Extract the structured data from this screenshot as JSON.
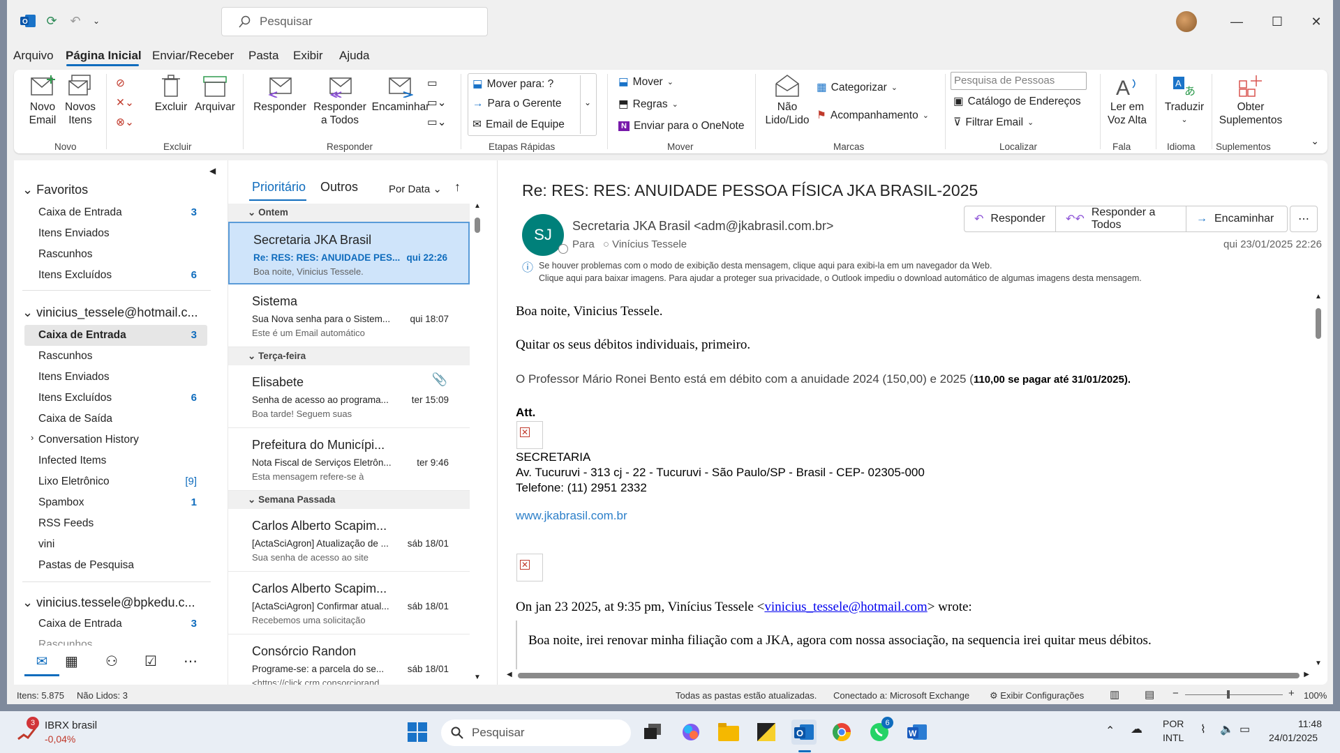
{
  "titlebar": {
    "search_placeholder": "Pesquisar"
  },
  "menu": [
    "Arquivo",
    "Página Inicial",
    "Enviar/Receber",
    "Pasta",
    "Exibir",
    "Ajuda"
  ],
  "ribbon": {
    "novo_email": "Novo\nEmail",
    "novos_itens": "Novos\nItens",
    "excluir": "Excluir",
    "arquivar": "Arquivar",
    "responder": "Responder",
    "responder_todos": "Responder\na Todos",
    "encaminhar": "Encaminhar",
    "qs1": "Mover para: ?",
    "qs2": "Para o Gerente",
    "qs3": "Email de Equipe",
    "mover": "Mover",
    "regras": "Regras",
    "onenote": "Enviar para o OneNote",
    "nao_lido": "Não\nLido/Lido",
    "categorizar": "Categorizar",
    "acompanhamento": "Acompanhamento",
    "pesquisa_pessoas": "Pesquisa de Pessoas",
    "catalogo": "Catálogo de Endereços",
    "filtrar": "Filtrar Email",
    "ler_voz": "Ler em\nVoz Alta",
    "traduzir": "Traduzir",
    "obter": "Obter\nSuplementos",
    "groups": [
      "Novo",
      "Excluir",
      "Responder",
      "Etapas Rápidas",
      "Mover",
      "Marcas",
      "Localizar",
      "Fala",
      "Idioma",
      "Suplementos"
    ]
  },
  "folders": {
    "favoritos": "Favoritos",
    "fav_items": [
      {
        "label": "Caixa de Entrada",
        "count": "3"
      },
      {
        "label": "Itens Enviados",
        "count": ""
      },
      {
        "label": "Rascunhos",
        "count": ""
      },
      {
        "label": "Itens Excluídos",
        "count": "6"
      }
    ],
    "account1": "vinicius_tessele@hotmail.c...",
    "acc1_items": [
      {
        "label": "Caixa de Entrada",
        "count": "3"
      },
      {
        "label": "Rascunhos",
        "count": ""
      },
      {
        "label": "Itens Enviados",
        "count": ""
      },
      {
        "label": "Itens Excluídos",
        "count": "6"
      },
      {
        "label": "Caixa de Saída",
        "count": ""
      },
      {
        "label": "Conversation History",
        "count": ""
      },
      {
        "label": "Infected Items",
        "count": ""
      },
      {
        "label": "Lixo Eletrônico",
        "count": "[9]"
      },
      {
        "label": "Spambox",
        "count": "1"
      },
      {
        "label": "RSS Feeds",
        "count": ""
      },
      {
        "label": "vini",
        "count": ""
      },
      {
        "label": "Pastas de Pesquisa",
        "count": ""
      }
    ],
    "account2": "vinicius.tessele@bpkedu.c...",
    "acc2_items": [
      {
        "label": "Caixa de Entrada",
        "count": "3"
      },
      {
        "label": "Rascunhos",
        "count": ""
      }
    ]
  },
  "list": {
    "tab_prioritario": "Prioritário",
    "tab_outros": "Outros",
    "sort": "Por Data",
    "sep_ontem": "Ontem",
    "sep_terca": "Terça-feira",
    "sep_semana": "Semana Passada",
    "messages": [
      {
        "sender": "Secretaria JKA Brasil",
        "subject": "Re: RES: RES: ANUIDADE PES...",
        "preview": "Boa noite, Vinicius Tessele.",
        "date": "qui 22:26"
      },
      {
        "sender": "Sistema",
        "subject": "Sua Nova senha para o Sistem...",
        "preview": "Este é um Email automático",
        "date": "qui 18:07"
      },
      {
        "sender": "Elisabete",
        "subject": "Senha de acesso ao programa...",
        "preview": "Boa tarde!  Seguem suas",
        "date": "ter 15:09"
      },
      {
        "sender": "Prefeitura do Municípi...",
        "subject": "Nota Fiscal de Serviços Eletrôn...",
        "preview": "Esta mensagem refere-se à",
        "date": "ter 9:46"
      },
      {
        "sender": "Carlos Alberto Scapim...",
        "subject": "[ActaSciAgron] Atualização de ...",
        "preview": "Sua senha de acesso ao site",
        "date": "sáb 18/01"
      },
      {
        "sender": "Carlos Alberto Scapim...",
        "subject": "[ActaSciAgron] Confirmar atual...",
        "preview": "Recebemos uma solicitação",
        "date": "sáb 18/01"
      },
      {
        "sender": "Consórcio Randon",
        "subject": "Programe-se: a parcela do se...",
        "preview": "<https://click.crm.consorciorand",
        "date": "sáb 18/01"
      }
    ]
  },
  "reading": {
    "subject": "Re: RES: RES: ANUIDADE PESSOA FÍSICA JKA BRASIL-2025",
    "btn_responder": "Responder",
    "btn_responder_todos": "Responder a Todos",
    "btn_encaminhar": "Encaminhar",
    "initials": "SJ",
    "from": "Secretaria JKA Brasil <adm@jkabrasil.com.br>",
    "to_label": "Para",
    "to": "Vinícius Tessele",
    "date": "qui 23/01/2025 22:26",
    "info1": "Se houver problemas com o modo de exibição desta mensagem, clique aqui para exibi-la em um navegador da Web.",
    "info2": "Clique aqui para baixar imagens. Para ajudar a proteger sua privacidade, o Outlook impediu o download automático de algumas imagens desta mensagem.",
    "l1": "Boa noite, Vinicius Tessele.",
    "l2": "Quitar os seus débitos individuais, primeiro.",
    "l3a": "O Professor Mário Ronei Bento está em débito com a anuidade 2024 (150,00) e 2025 (",
    "l3b": "110,00 se pagar até 31/01/2025).",
    "att": "Att.",
    "sec": "SECRETARIA",
    "addr": "Av. Tucuruvi - 313 cj - 22 - Tucuruvi - São Paulo/SP - Brasil - CEP- 02305-000",
    "tel": "Telefone: (11) 2951 2332",
    "site": "www.jkabrasil.com.br",
    "quote_a": "On jan 23 2025, at 9:35 pm, Vinícius Tessele <",
    "quote_email": "vinicius_tessele@hotmail.com",
    "quote_b": "> wrote:",
    "quote_body": "Boa noite, irei renovar minha filiação com a JKA, agora com nossa associação, na sequencia irei quitar meus débitos."
  },
  "status": {
    "itens": "Itens: 5.875",
    "nao_lidos": "Não Lidos: 3",
    "atualizadas": "Todas as pastas estão atualizadas.",
    "conectado": "Conectado a: Microsoft Exchange",
    "config": "Exibir Configurações",
    "zoom": "100%"
  },
  "taskbar": {
    "stock_name": "IBRX brasil",
    "stock_change": "-0,04%",
    "stock_badge": "3",
    "search": "Pesquisar",
    "lang1": "POR",
    "lang2": "INTL",
    "time": "11:48",
    "date": "24/01/2025",
    "whatsapp_badge": "6"
  },
  "colors": {
    "accent": "#0f6cbd",
    "selected": "#cfe4fa",
    "avatar": "#00807a"
  }
}
